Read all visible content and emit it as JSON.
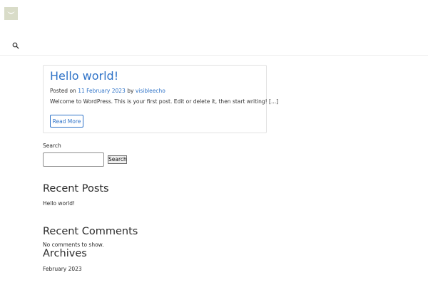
{
  "header": {
    "logo_icon": "site-logo-icon",
    "search_icon": "search-icon"
  },
  "post": {
    "title": "Hello world!",
    "meta_prefix": "Posted on",
    "date": "11 February 2023",
    "meta_by": "by",
    "author": "visibleecho",
    "excerpt": "Welcome to WordPress. This is your first post. Edit or delete it, then start writing! [...]",
    "read_more": "Read More"
  },
  "search_widget": {
    "label": "Search",
    "value": "",
    "button": "Search"
  },
  "recent_posts": {
    "heading": "Recent Posts",
    "items": [
      "Hello world!"
    ]
  },
  "recent_comments": {
    "heading": "Recent Comments",
    "empty_text": "No comments to show."
  },
  "archives": {
    "heading": "Archives",
    "items": [
      "February 2023"
    ]
  },
  "colors": {
    "link": "#2f73c8",
    "logo_bg": "#d9dcc8"
  }
}
